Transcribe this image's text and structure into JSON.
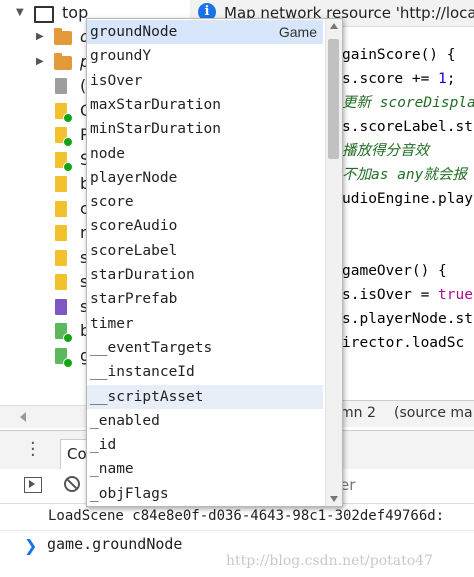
{
  "tree": {
    "root_label": "top",
    "rows": [
      {
        "label": "d",
        "kind": "folder",
        "expand": "▶"
      },
      {
        "label": "p",
        "kind": "folder",
        "expand": "▶"
      },
      {
        "label": "(i",
        "kind": "file-gray"
      },
      {
        "label": "G",
        "kind": "file-yellow",
        "badge": true
      },
      {
        "label": "P",
        "kind": "file-yellow",
        "badge": true
      },
      {
        "label": "S",
        "kind": "file-yellow",
        "badge": true
      },
      {
        "label": "b",
        "kind": "file-yellow"
      },
      {
        "label": "c",
        "kind": "file-yellow"
      },
      {
        "label": "n",
        "kind": "file-yellow"
      },
      {
        "label": "s",
        "kind": "file-yellow"
      },
      {
        "label": "s",
        "kind": "file-yellow"
      },
      {
        "label": "s",
        "kind": "file-purple"
      },
      {
        "label": "b",
        "kind": "file-green",
        "badge": true
      },
      {
        "label": "g",
        "kind": "file-green",
        "badge": true
      }
    ]
  },
  "info_bar": {
    "icon": "info-icon",
    "text": "Map network resource 'http://local"
  },
  "code_lines": [
    [
      {
        "t": "gainScore() {",
        "c": ""
      }
    ],
    [
      {
        "t": "s.",
        "c": ""
      },
      {
        "t": "score",
        "c": ""
      },
      {
        "t": " += ",
        "c": ""
      },
      {
        "t": "1",
        "c": "num"
      },
      {
        "t": ";",
        "c": ""
      }
    ],
    [
      {
        "t": "更新 scoreDispla",
        "c": "cm"
      }
    ],
    [
      {
        "t": "s.scoreLabel.str",
        "c": ""
      }
    ],
    [
      {
        "t": "播放得分音效",
        "c": "cm"
      }
    ],
    [
      {
        "t": "不加as any就会报",
        "c": "cm"
      }
    ],
    [
      {
        "t": "udioEngine.play",
        "c": ""
      }
    ],
    [
      {
        "t": "",
        "c": ""
      }
    ],
    [
      {
        "t": "",
        "c": ""
      }
    ],
    [
      {
        "t": "gameOver() {",
        "c": ""
      }
    ],
    [
      {
        "t": "s.isOver = ",
        "c": ""
      },
      {
        "t": "true",
        "c": "kw"
      }
    ],
    [
      {
        "t": "s.playerNode.st",
        "c": ""
      }
    ],
    [
      {
        "t": "irector.loadSc",
        "c": ""
      }
    ]
  ],
  "status_bar": {
    "position": "mn 2",
    "source": "(source ma"
  },
  "drawer": {
    "console_tab": "Co",
    "filter_placeholder": "er"
  },
  "console": {
    "message": "LoadScene c84e8e0f-d036-4643-98c1-302def49766d:",
    "prompt": "❯",
    "input": "game.groundNode"
  },
  "watermark": "http://blog.csdn.net/potato47",
  "autocomplete": {
    "items": [
      {
        "label": "groundNode",
        "type": "Game",
        "state": "selected"
      },
      {
        "label": "groundY",
        "type": "",
        "state": ""
      },
      {
        "label": "isOver",
        "type": "",
        "state": ""
      },
      {
        "label": "maxStarDuration",
        "type": "",
        "state": ""
      },
      {
        "label": "minStarDuration",
        "type": "",
        "state": ""
      },
      {
        "label": "node",
        "type": "",
        "state": ""
      },
      {
        "label": "playerNode",
        "type": "",
        "state": ""
      },
      {
        "label": "score",
        "type": "",
        "state": ""
      },
      {
        "label": "scoreAudio",
        "type": "",
        "state": ""
      },
      {
        "label": "scoreLabel",
        "type": "",
        "state": ""
      },
      {
        "label": "starDuration",
        "type": "",
        "state": ""
      },
      {
        "label": "starPrefab",
        "type": "",
        "state": ""
      },
      {
        "label": "timer",
        "type": "",
        "state": ""
      },
      {
        "label": "__eventTargets",
        "type": "",
        "state": ""
      },
      {
        "label": "__instanceId",
        "type": "",
        "state": ""
      },
      {
        "label": "__scriptAsset",
        "type": "",
        "state": "hover"
      },
      {
        "label": "_enabled",
        "type": "",
        "state": ""
      },
      {
        "label": "_id",
        "type": "",
        "state": ""
      },
      {
        "label": "_name",
        "type": "",
        "state": ""
      },
      {
        "label": "_objFlags",
        "type": "",
        "state": ""
      }
    ]
  },
  "colors": {
    "accent": "#1a73e8",
    "selection": "#d7e6fb",
    "folder": "#e39a3b",
    "file_yellow": "#f2c12e",
    "file_gray": "#9e9e9e",
    "file_purple": "#7e57c2",
    "file_green": "#5cb85c",
    "badge": "#16a316"
  }
}
